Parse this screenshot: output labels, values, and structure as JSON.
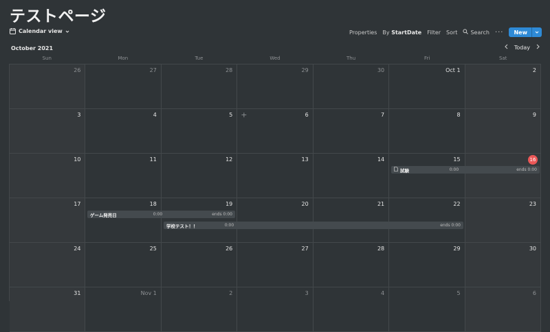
{
  "page": {
    "title": "テストページ"
  },
  "toolbar": {
    "view_label": "Calendar view",
    "view_icon": "calendar-icon",
    "properties_label": "Properties",
    "by_label": "By",
    "by_value": "StartDate",
    "filter_label": "Filter",
    "sort_label": "Sort",
    "search_label": "Search",
    "more_label": "···",
    "new_label": "New",
    "new_color": "#2e8ad6"
  },
  "calendar": {
    "month_label": "October 2021",
    "today_label": "Today",
    "weekdays": [
      "Sun",
      "Mon",
      "Tue",
      "Wed",
      "Thu",
      "Fri",
      "Sat"
    ],
    "today_color": "#eb5757",
    "weeks": [
      [
        "26",
        "27",
        "28",
        "29",
        "30",
        "Oct 1",
        "2"
      ],
      [
        "3",
        "4",
        "5",
        "6",
        "7",
        "8",
        "9"
      ],
      [
        "10",
        "11",
        "12",
        "13",
        "14",
        "15",
        "16"
      ],
      [
        "17",
        "18",
        "19",
        "20",
        "21",
        "22",
        "23"
      ],
      [
        "24",
        "25",
        "26",
        "27",
        "28",
        "29",
        "30"
      ],
      [
        "31",
        "Nov 1",
        "2",
        "3",
        "4",
        "5",
        "6"
      ]
    ],
    "events": [
      {
        "title": "試験",
        "start_time": "0:00",
        "end_time": "ends 0:00"
      },
      {
        "title": "ゲーム発売日",
        "start_time": "0:00",
        "end_time": "ends 0:00"
      },
      {
        "title": "学校テスト！！",
        "start_time": "0:00",
        "end_time": "ends 0:00"
      }
    ]
  }
}
